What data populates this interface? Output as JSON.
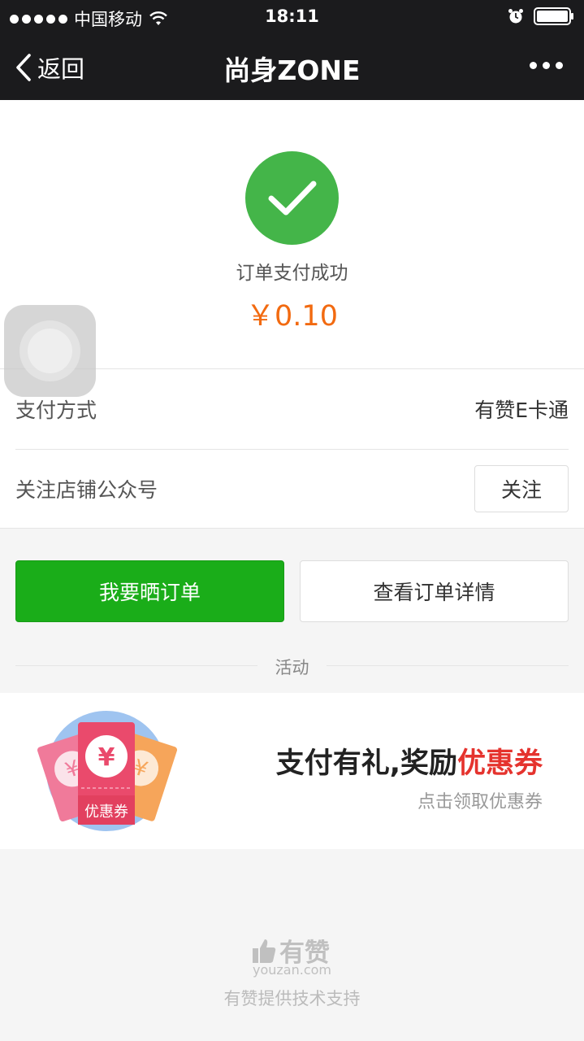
{
  "status_bar": {
    "carrier": "中国移动",
    "time": "18:11"
  },
  "nav": {
    "back_label": "返回",
    "title": "尚身ZONE"
  },
  "payment": {
    "status_text": "订单支付成功",
    "amount": "￥0.10",
    "amount_color": "#f26a10",
    "success_color": "#44b549"
  },
  "info_rows": {
    "method_label": "支付方式",
    "method_value": "有赞E卡通",
    "follow_label": "关注店铺公众号",
    "follow_button": "关注"
  },
  "actions": {
    "share_order": "我要晒订单",
    "view_details": "查看订单详情",
    "primary_color": "#1aad19"
  },
  "activity": {
    "section_label": "活动",
    "promo_title_prefix": "支付有礼,奖励",
    "promo_title_highlight": "优惠券",
    "promo_subtitle": "点击领取优惠券",
    "coupon_badge": "优惠券",
    "coupon_symbol": "¥"
  },
  "footer": {
    "brand": "有赞",
    "domain": "youzan.com",
    "support_text": "有赞提供技术支持"
  }
}
